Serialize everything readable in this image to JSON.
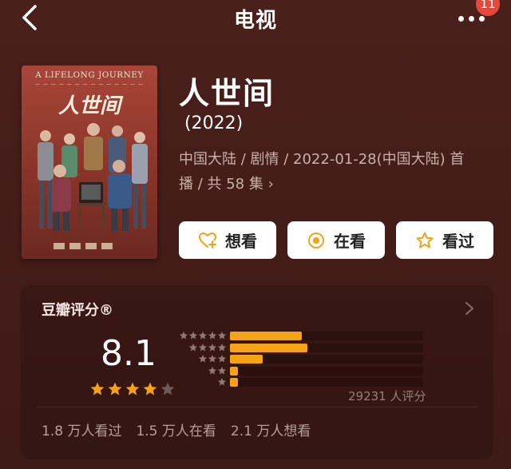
{
  "header": {
    "title": "电视",
    "back_icon": "chevron-left-icon",
    "more_icon": "ellipsis-icon",
    "badge_count": "11"
  },
  "poster": {
    "title_en": "A LIFELONG JOURNEY",
    "title_cn": "人世间"
  },
  "show": {
    "name": "人世间",
    "year": "(2022)",
    "meta_line1": "中国大陆 / 剧情 / 2022-01-28(中国大陆) 首",
    "meta_line2": "播 / 共 58 集 ›"
  },
  "actions": {
    "want": "想看",
    "watching": "在看",
    "watched": "看过"
  },
  "rating": {
    "title": "豆瓣评分®",
    "score": "8.1",
    "score_stars": 4,
    "distribution": [
      {
        "stars": 5,
        "fraction": 0.37
      },
      {
        "stars": 4,
        "fraction": 0.4
      },
      {
        "stars": 3,
        "fraction": 0.17
      },
      {
        "stars": 2,
        "fraction": 0.04
      },
      {
        "stars": 1,
        "fraction": 0.04
      }
    ],
    "count_text": "29231 人评分",
    "stats": [
      "1.8 万人看过",
      "1.5 万人在看",
      "2.1 万人想看"
    ]
  },
  "colors": {
    "background": "#45201b",
    "accent": "#f6a217",
    "button_bg": "#ffffff"
  }
}
